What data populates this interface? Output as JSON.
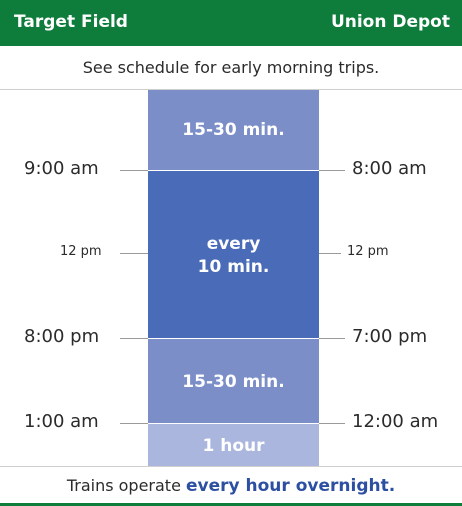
{
  "header": {
    "left": "Target Field",
    "right": "Union Depot"
  },
  "top_note": "See schedule for early morning trips.",
  "bands": [
    {
      "label": "15-30 min.",
      "color": "#7b8ec8"
    },
    {
      "label_line1": "every",
      "label_line2": "10 min.",
      "color": "#4a6bb8"
    },
    {
      "label": "15-30 min.",
      "color": "#7b8ec8"
    },
    {
      "label": "1 hour",
      "color": "#aab6de"
    }
  ],
  "left_times": [
    "9:00 am",
    "12 pm",
    "8:00 pm",
    "1:00 am"
  ],
  "right_times": [
    "8:00 am",
    "12 pm",
    "7:00 pm",
    "12:00 am"
  ],
  "footer": {
    "prefix": "Trains operate ",
    "highlight": "every hour overnight."
  },
  "colors": {
    "header_green": "#0e7c3a",
    "highlight_blue": "#2d4fa2"
  }
}
